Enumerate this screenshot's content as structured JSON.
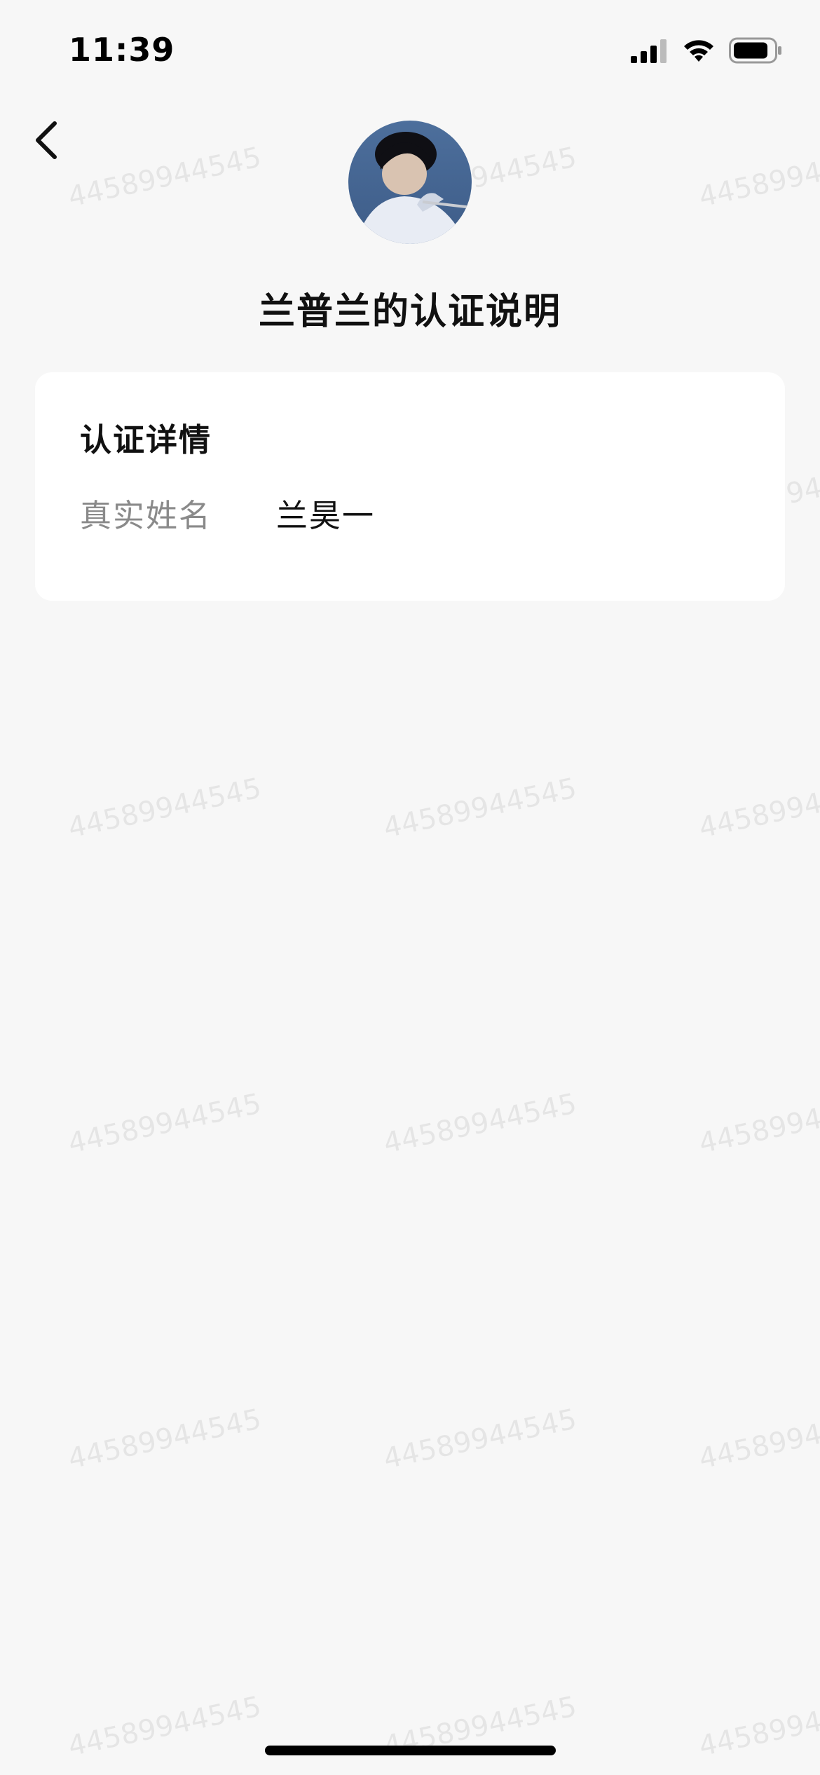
{
  "status_bar": {
    "time": "11:39",
    "icons": [
      "signal-icon",
      "wifi-icon",
      "battery-icon"
    ]
  },
  "header": {
    "back_icon": "chevron-left-icon",
    "title": "兰普兰的认证说明"
  },
  "card": {
    "title": "认证详情",
    "rows": [
      {
        "label": "真实姓名",
        "value": "兰昊一"
      }
    ]
  },
  "watermark": {
    "text": "44589944545"
  },
  "colors": {
    "background": "#f7f7f7",
    "card": "#ffffff",
    "text_primary": "#111111",
    "text_secondary": "#8a8a8a"
  }
}
